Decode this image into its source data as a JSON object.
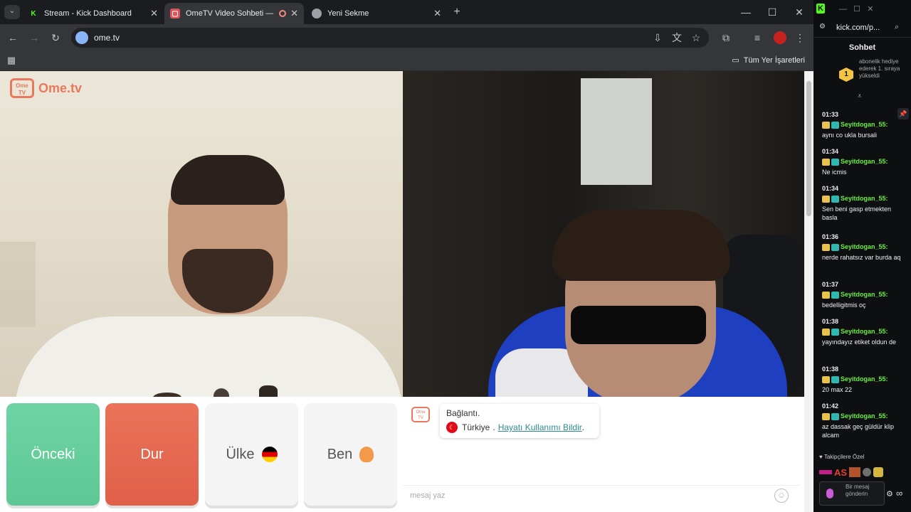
{
  "tabs": [
    {
      "label": "Stream - Kick Dashboard",
      "favicon": "kick-icon"
    },
    {
      "label": "OmeTV Video Sohbeti — O",
      "favicon": "ometv-icon"
    },
    {
      "label": "Yeni Sekme",
      "favicon": "chrome-icon"
    }
  ],
  "address": {
    "url": "ome.tv"
  },
  "bookmarks": {
    "all_bookmarks": "Tüm Yer İşaretleri"
  },
  "logo": {
    "text": "Ome.tv",
    "badge": "Ome TV"
  },
  "buttons": {
    "previous": "Önceki",
    "stop": "Dur",
    "country": "Ülke",
    "me": "Ben"
  },
  "chat": {
    "status": "Bağlantı.",
    "country": "Türkiye",
    "separator": ".",
    "report_link": "Hayatı Kullanımı Bildir",
    "link_end": ".",
    "placeholder": "mesaj yaz"
  },
  "side": {
    "url": "kick.com/p...",
    "title": "Sohbet",
    "pinned": {
      "rank": "1",
      "text": "abonelik hediye ederek 1. sıraya yükseldi"
    },
    "messages": [
      {
        "time": "01:33",
        "user": "Seyitdogan_55:",
        "text": "aynı co ukla bursali"
      },
      {
        "time": "01:34",
        "user": "Seyitdogan_55:",
        "text": "Ne icmis"
      },
      {
        "time": "01:34",
        "user": "Seyitdogan_55:",
        "text": "Sen beni gasp etmekten basla"
      },
      {
        "time": "01:36",
        "user": "Seyitdogan_55:",
        "text": "nerde rahatsız var burda aq"
      },
      {
        "time": "01:37",
        "user": "Seyitdogan_55:",
        "text": "bedelligitmis oç"
      },
      {
        "time": "01:38",
        "user": "Seyitdogan_55:",
        "text": "yayındayız etiket oldun de"
      },
      {
        "time": "01:38",
        "user": "Seyitdogan_55:",
        "text": "20 max 22"
      },
      {
        "time": "01:42",
        "user": "Seyitdogan_55:",
        "text": "az dassak geç güldür klip alcam"
      }
    ],
    "followers_label": "Takipçilere Özel",
    "emote_text": "AS",
    "send_placeholder": "Bir mesaj gönderin",
    "kick_green": "#53fc18"
  }
}
